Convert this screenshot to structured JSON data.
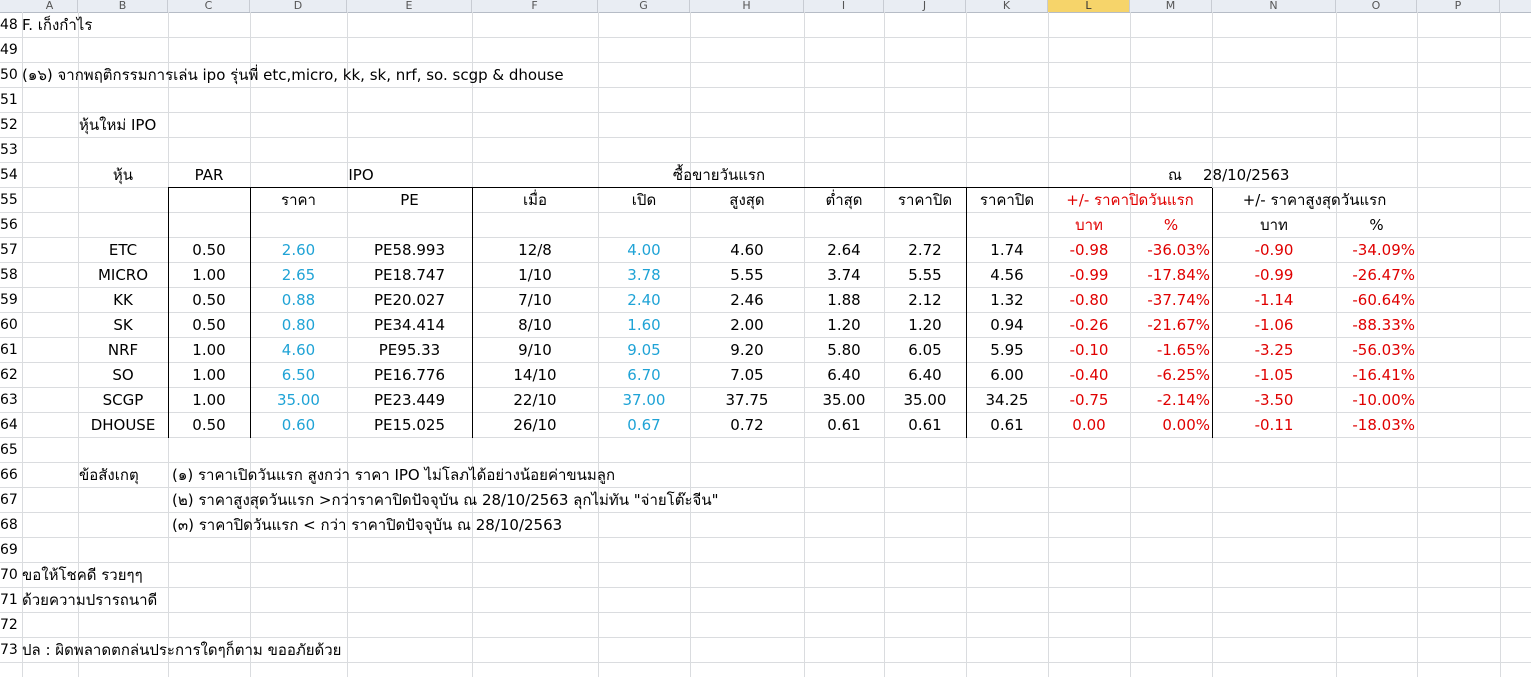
{
  "column_headers": [
    "A",
    "B",
    "C",
    "D",
    "E",
    "F",
    "G",
    "H",
    "I",
    "J",
    "K",
    "L",
    "M",
    "N",
    "O",
    "P"
  ],
  "row_numbers": [
    "48",
    "49",
    "50",
    "51",
    "52",
    "53",
    "54",
    "55",
    "56",
    "57",
    "58",
    "59",
    "60",
    "61",
    "62",
    "63",
    "64",
    "65",
    "66",
    "67",
    "68",
    "69",
    "70",
    "71",
    "72",
    "73"
  ],
  "rows": {
    "r48": "F. เก็งกำไร",
    "r50": "(๑๖) จากพฤติกรรมการเล่น ipo รุ่นพี่ etc,micro, kk, sk, nrf, so. scgp & dhouse",
    "r52": "หุ้นใหม่   IPO",
    "r70": "ขอให้โชคดี รวยๆๆ",
    "r71": "ด้วยความปรารถนาดี",
    "r73": "ปล :  ผิดพลาดตกล่นประการใดๆก็ตาม ขออภัยด้วย"
  },
  "table": {
    "h_stock": "หุ้น",
    "h_par": "PAR",
    "h_ipo": "IPO",
    "h_firstday": "ซื้อขายวันแรก",
    "h_asof": "ณ",
    "h_asof_date": "28/10/2563",
    "h_price": "ราคา",
    "h_pe": "PE",
    "h_when": "เมื่อ",
    "h_open": "เปิด",
    "h_high": "สูงสุด",
    "h_low": "ต่ำสุด",
    "h_close": "ราคาปิด",
    "h_close_now": "ราคาปิด",
    "h_diff_close": "+/- ราคาปิดวันแรก",
    "h_diff_high": "+/- ราคาสูงสุดวันแรก",
    "h_baht1": "บาท",
    "h_pct1": "%",
    "h_baht2": "บาท",
    "h_pct2": "%",
    "data": [
      {
        "stock": "ETC",
        "par": "0.50",
        "price": "2.60",
        "pe": "PE58.993",
        "when": "12/8",
        "open": "4.00",
        "high": "4.60",
        "low": "2.64",
        "close": "2.72",
        "now": "1.74",
        "d1b": "-0.98",
        "d1p": "-36.03%",
        "d2b": "-0.90",
        "d2p": "-34.09%"
      },
      {
        "stock": "MICRO",
        "par": "1.00",
        "price": "2.65",
        "pe": "PE18.747",
        "when": "1/10",
        "open": "3.78",
        "high": "5.55",
        "low": "3.74",
        "close": "5.55",
        "now": "4.56",
        "d1b": "-0.99",
        "d1p": "-17.84%",
        "d2b": "-0.99",
        "d2p": "-26.47%"
      },
      {
        "stock": "KK",
        "par": "0.50",
        "price": "0.88",
        "pe": "PE20.027",
        "when": "7/10",
        "open": "2.40",
        "high": "2.46",
        "low": "1.88",
        "close": "2.12",
        "now": "1.32",
        "d1b": "-0.80",
        "d1p": "-37.74%",
        "d2b": "-1.14",
        "d2p": "-60.64%"
      },
      {
        "stock": "SK",
        "par": "0.50",
        "price": "0.80",
        "pe": "PE34.414",
        "when": "8/10",
        "open": "1.60",
        "high": "2.00",
        "low": "1.20",
        "close": "1.20",
        "now": "0.94",
        "d1b": "-0.26",
        "d1p": "-21.67%",
        "d2b": "-1.06",
        "d2p": "-88.33%"
      },
      {
        "stock": "NRF",
        "par": "1.00",
        "price": "4.60",
        "pe": "PE95.33",
        "when": "9/10",
        "open": "9.05",
        "high": "9.20",
        "low": "5.80",
        "close": "6.05",
        "now": "5.95",
        "d1b": "-0.10",
        "d1p": "-1.65%",
        "d2b": "-3.25",
        "d2p": "-56.03%"
      },
      {
        "stock": "SO",
        "par": "1.00",
        "price": "6.50",
        "pe": "PE16.776",
        "when": "14/10",
        "open": "6.70",
        "high": "7.05",
        "low": "6.40",
        "close": "6.40",
        "now": "6.00",
        "d1b": "-0.40",
        "d1p": "-6.25%",
        "d2b": "-1.05",
        "d2p": "-16.41%"
      },
      {
        "stock": "SCGP",
        "par": "1.00",
        "price": "35.00",
        "pe": "PE23.449",
        "when": "22/10",
        "open": "37.00",
        "high": "37.75",
        "low": "35.00",
        "close": "35.00",
        "now": "34.25",
        "d1b": "-0.75",
        "d1p": "-2.14%",
        "d2b": "-3.50",
        "d2p": "-10.00%"
      },
      {
        "stock": "DHOUSE",
        "par": "0.50",
        "price": "0.60",
        "pe": "PE15.025",
        "when": "26/10",
        "open": "0.67",
        "high": "0.72",
        "low": "0.61",
        "close": "0.61",
        "now": "0.61",
        "d1b": "0.00",
        "d1p": "0.00%",
        "d2b": "-0.11",
        "d2p": "-18.03%"
      }
    ]
  },
  "notes": {
    "label": "ข้อสังเกตุ",
    "n1": "(๑) ราคาเปิดวันแรก   สูงกว่า   ราคา   IPO ไม่โลภได้อย่างน้อยค่าขนมลูก",
    "n2": "(๒) ราคาสูงสุดวันแรก   >กว่าราคาปิดปัจจุบัน   ณ   28/10/2563 ลุกไม่ทัน   \"จ่ายโต๊ะจีน\"",
    "n3": "(๓) ราคาปิดวันแรก   < กว่า   ราคาปิดปัจจุบัน   ณ   28/10/2563"
  },
  "colors": {
    "blue": "#1fa3d6",
    "red": "#e00000",
    "selected_col": "#f6d46a"
  }
}
